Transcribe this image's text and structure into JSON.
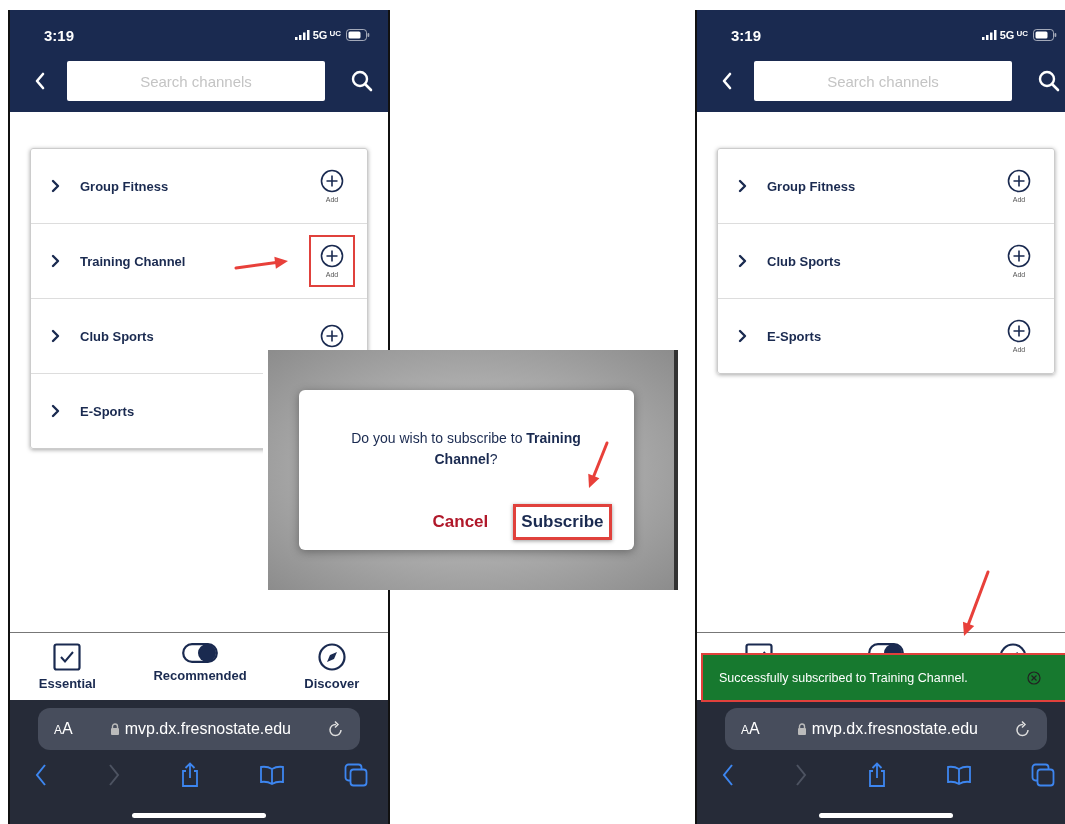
{
  "phones": [
    {
      "status": {
        "time": "3:19",
        "network": "5G",
        "network_suffix": "UC"
      },
      "search": {
        "placeholder": "Search channels"
      },
      "channels": [
        {
          "name": "Group Fitness",
          "add_icon": true,
          "add_label": "Add",
          "highlighted": false
        },
        {
          "name": "Training Channel",
          "add_icon": true,
          "add_label": "Add",
          "highlighted": true
        },
        {
          "name": "Club Sports",
          "add_icon": true,
          "highlighted": false
        },
        {
          "name": "E-Sports",
          "add_icon": false
        }
      ],
      "bottom_nav": [
        {
          "kind": "checkbox",
          "label": "Essential"
        },
        {
          "kind": "toggle",
          "label": "Recommended",
          "on": true
        },
        {
          "kind": "compass",
          "label": "Discover"
        }
      ],
      "browser": {
        "text_size": "AA",
        "url": "mvp.dx.fresnostate.edu",
        "forward_enabled": false
      }
    },
    {
      "status": {
        "time": "3:19",
        "network": "5G",
        "network_suffix": "UC"
      },
      "search": {
        "placeholder": "Search channels"
      },
      "channels": [
        {
          "name": "Group Fitness",
          "add_icon": true,
          "add_label": "Add",
          "highlighted": false
        },
        {
          "name": "Club Sports",
          "add_icon": true,
          "add_label": "Add",
          "highlighted": false
        },
        {
          "name": "E-Sports",
          "add_icon": true,
          "add_label": "Add",
          "highlighted": false
        }
      ],
      "bottom_nav": [
        {
          "kind": "checkbox"
        },
        {
          "kind": "toggle",
          "on": true
        },
        {
          "kind": "compass"
        }
      ],
      "browser": {
        "text_size": "AA",
        "url": "mvp.dx.fresnostate.edu",
        "forward_enabled": false
      },
      "toast": {
        "message": "Successfully subscribed to Training Channel.",
        "highlighted": true
      }
    }
  ],
  "dialog": {
    "message": "Do you wish to subscribe to **Training Channel**?",
    "buttons": [
      {
        "kind": "cancel",
        "label": "Cancel",
        "highlighted": false
      },
      {
        "kind": "confirm",
        "label": "Subscribe",
        "highlighted": true
      }
    ]
  }
}
